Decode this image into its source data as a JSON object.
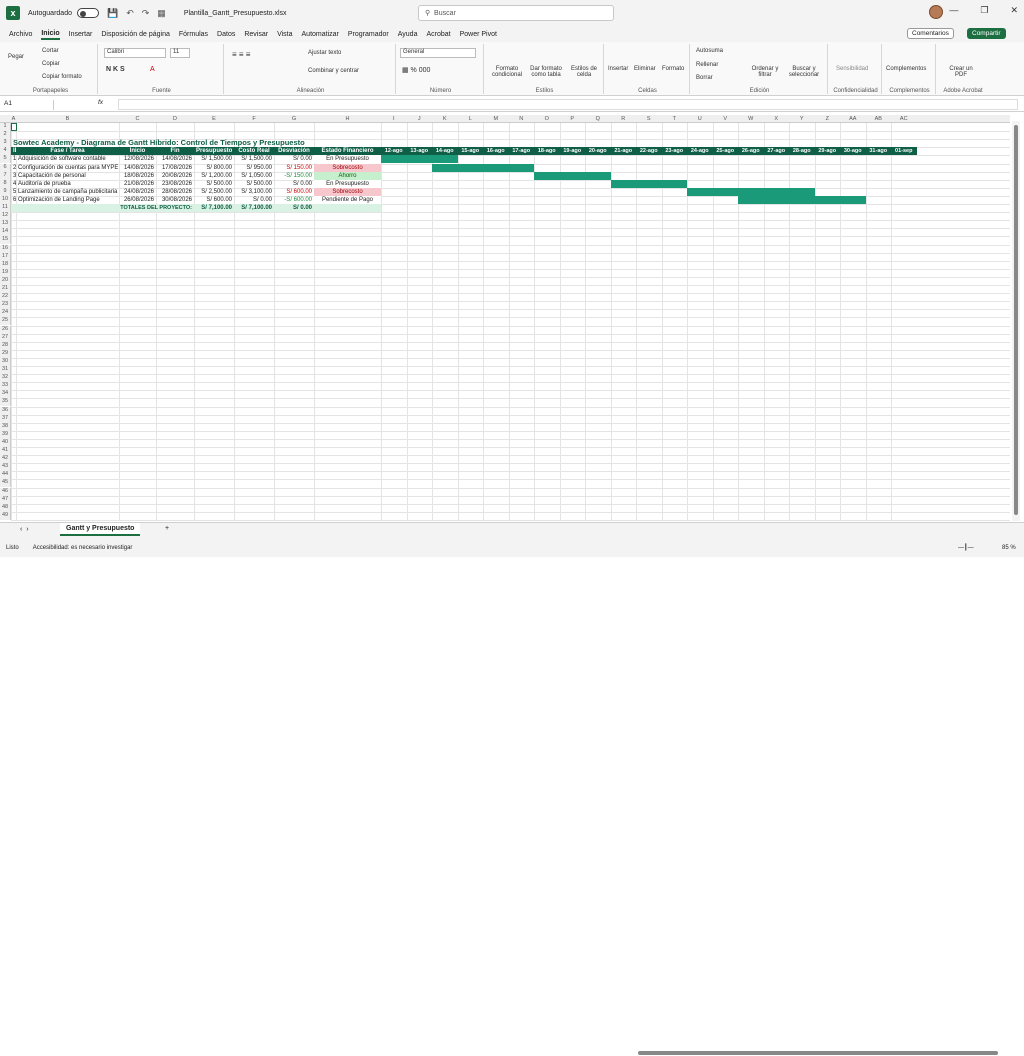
{
  "titlebar": {
    "autosave": "Autoguardado",
    "filename": "Plantilla_Gantt_Presupuesto.xlsx",
    "search": "Buscar"
  },
  "tabs": [
    "Archivo",
    "Inicio",
    "Insertar",
    "Disposición de página",
    "Fórmulas",
    "Datos",
    "Revisar",
    "Vista",
    "Automatizar",
    "Programador",
    "Ayuda",
    "Acrobat",
    "Power Pivot"
  ],
  "buttons": {
    "comments": "Comentarios",
    "share": "Compartir"
  },
  "ribbon": {
    "portapapeles": {
      "label": "Portapapeles",
      "paste": "Pegar",
      "cut": "Cortar",
      "copy": "Copiar",
      "format": "Copiar formato"
    },
    "fuente": {
      "label": "Fuente",
      "font": "Calibri",
      "size": "11"
    },
    "alineacion": {
      "label": "Alineación",
      "wrap": "Ajustar texto",
      "merge": "Combinar y centrar"
    },
    "numero": {
      "label": "Número",
      "format": "General"
    },
    "estilos": {
      "label": "Estilos",
      "cond": "Formato condicional",
      "table": "Dar formato como tabla",
      "cell": "Estilos de celda"
    },
    "celdas": {
      "label": "Celdas",
      "insert": "Insertar",
      "delete": "Eliminar",
      "format": "Formato"
    },
    "edicion": {
      "label": "Edición",
      "autosum": "Autosuma",
      "fill": "Rellenar",
      "clear": "Borrar",
      "sort": "Ordenar y filtrar",
      "find": "Buscar y seleccionar"
    },
    "conf": {
      "label": "Confidencialidad",
      "sens": "Sensibilidad"
    },
    "compl": {
      "label": "Complementos",
      "btn": "Complementos"
    },
    "acrobat": {
      "label": "Adobe Acrobat",
      "btn": "Crear un PDF"
    }
  },
  "formula": {
    "namebox": "A1",
    "fx": "fx"
  },
  "sheet": {
    "title": "Sowtec Academy - Diagrama de Gantt Híbrido: Control de Tiempos y Presupuesto",
    "headers": [
      "ID",
      "Fase / Tarea",
      "Inicio",
      "Fin",
      "Presupuesto",
      "Costo Real",
      "Desviación",
      "Estado Financiero"
    ],
    "dates": [
      "12-ago",
      "13-ago",
      "14-ago",
      "15-ago",
      "16-ago",
      "17-ago",
      "18-ago",
      "19-ago",
      "20-ago",
      "21-ago",
      "22-ago",
      "23-ago",
      "24-ago",
      "25-ago",
      "26-ago",
      "27-ago",
      "28-ago",
      "29-ago",
      "30-ago",
      "31-ago",
      "01-sep"
    ],
    "rows": [
      {
        "id": "1",
        "task": "Adquisición de software contable",
        "start": "12/08/2026",
        "end": "14/08/2026",
        "budget": "S/ 1,500.00",
        "cost": "S/ 1,500.00",
        "dev": "S/ 0.00",
        "status": "En Presupuesto",
        "gs": 0,
        "ge": 2
      },
      {
        "id": "2",
        "task": "Configuración de cuentas para MYPE",
        "start": "14/08/2026",
        "end": "17/08/2026",
        "budget": "S/ 800.00",
        "cost": "S/ 950.00",
        "dev": "S/ 150.00",
        "status": "Sobrecosto",
        "gs": 2,
        "ge": 5
      },
      {
        "id": "3",
        "task": "Capacitación de personal",
        "start": "18/08/2026",
        "end": "20/08/2026",
        "budget": "S/ 1,200.00",
        "cost": "S/ 1,050.00",
        "dev": "-S/ 150.00",
        "status": "Ahorro",
        "gs": 6,
        "ge": 8
      },
      {
        "id": "4",
        "task": "Auditoría de prueba",
        "start": "21/08/2026",
        "end": "23/08/2026",
        "budget": "S/ 500.00",
        "cost": "S/ 500.00",
        "dev": "S/ 0.00",
        "status": "En Presupuesto",
        "gs": 9,
        "ge": 11
      },
      {
        "id": "5",
        "task": "Lanzamiento de campaña publicitaria",
        "start": "24/08/2026",
        "end": "28/08/2026",
        "budget": "S/ 2,500.00",
        "cost": "S/ 3,100.00",
        "dev": "S/ 600.00",
        "status": "Sobrecosto",
        "gs": 12,
        "ge": 16
      },
      {
        "id": "6",
        "task": "Optimización de Landing Page",
        "start": "26/08/2026",
        "end": "30/08/2026",
        "budget": "S/ 600.00",
        "cost": "S/ 0.00",
        "dev": "-S/ 600.00",
        "status": "Pendiente de Pago",
        "gs": 14,
        "ge": 18
      }
    ],
    "totals": {
      "label": "TOTALES DEL PROYECTO:",
      "budget": "S/ 7,100.00",
      "cost": "S/ 7,100.00",
      "dev": "S/ 0.00"
    }
  },
  "sheettab": "Gantt y Presupuesto",
  "status": {
    "ready": "Listo",
    "access": "Accesibilidad: es necesario investigar",
    "zoom": "85 %"
  },
  "colors": {
    "header": "#0f5e46",
    "gantt": "#1a9a79",
    "over": "#f7c7ce",
    "save": "#c6efce"
  }
}
